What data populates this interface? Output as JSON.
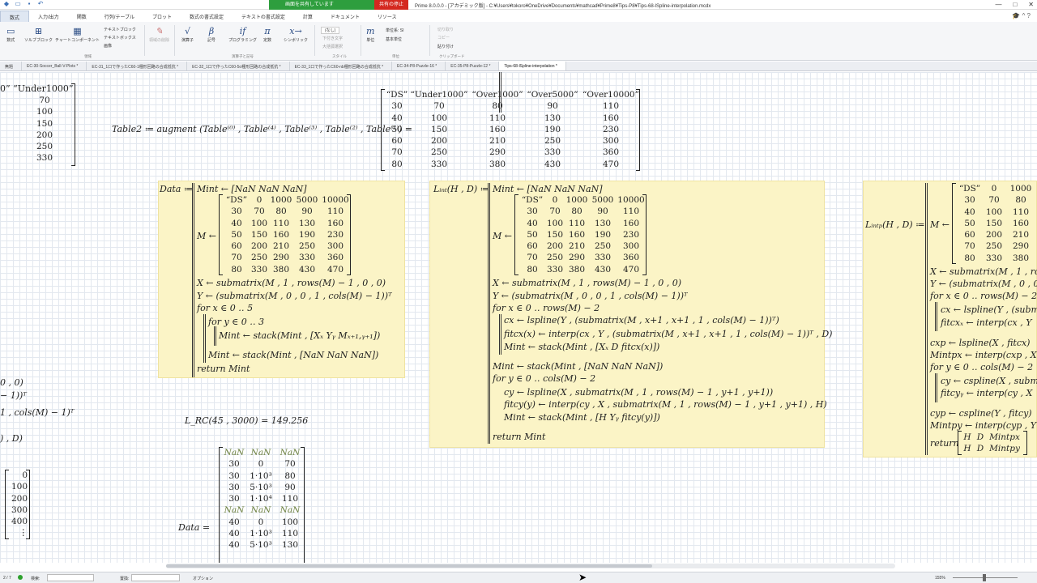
{
  "titlebar": {
    "share_banner": "画面を共有しています",
    "stop_share": "共有の停止",
    "window_title": "Prime 8.0.0.0 - [アカデミック版] - C:¥Users¥tokoro¥OneDrive¥Documents¥mathcad¥Prime8¥Tips-P8¥Tips-68-lSpline-interpolation.mcdx",
    "min": "—",
    "max": "□",
    "close": "✕"
  },
  "ribbon_tabs": [
    "数式",
    "入力/出力",
    "関数",
    "行列/テーブル",
    "プロット",
    "数式の書式設定",
    "テキストの書式設定",
    "計算",
    "ドキュメント",
    "リソース"
  ],
  "ribbon": {
    "b_math": "数式",
    "b_solve": "ソルブブロック",
    "b_chart": "チャートコンポーネント",
    "b_textblock": "テキストブロック",
    "b_textbox": "テキストボックス",
    "b_image": "画像",
    "b_clear": "領域の削除",
    "b_operator": "演算子",
    "b_symbols": "記号",
    "b_programming": "プログラミング",
    "b_constants": "定数",
    "b_symbolic": "シンボリック",
    "style_label": "(なし)",
    "style_sub": "ラベル(-)",
    "style_a": "下付き文字",
    "style_b": "大括弧選択",
    "b_units": "単位",
    "units_a": "単位系: SI",
    "units_b": "基本単位",
    "cut": "切り取り",
    "copy": "コピー",
    "paste": "貼り付け",
    "g_regions": "領域",
    "g_operators": "演算子と記号",
    "g_style": "スタイル",
    "g_units": "単位",
    "g_clipboard": "クリップボード",
    "icon_math": "▭",
    "icon_solve": "⊞",
    "icon_chart": "▦",
    "icon_op": "√",
    "icon_sym": "β",
    "icon_prog": "if",
    "icon_const": "π",
    "icon_symb": "x→",
    "icon_units": "m"
  },
  "doc_tabs": [
    "無題",
    "EC-30-Soccer_Ball-V-Plots *",
    "EC-31_1口で作ったC60-1種形回路の合成抵抗 *",
    "EC-32_1口で作ったC60-5o種形回路の合成抵抗 *",
    "EC-33_1口で作ったC60-nb種形回路の合成抵抗 *",
    "EC-34-P8-Puzzle-16 *",
    "EC-35-P8-Puzzle-12 *",
    "Tips-68-lSpline-interpolation *"
  ],
  "sheet": {
    "left_partial": {
      "h0": "0”",
      "h1": "“Under1000”",
      "vals": [
        "70",
        "100",
        "150",
        "200",
        "250",
        "330"
      ]
    },
    "table2_lhs": "Table2 ≔ augment",
    "table2_args": "(Table⁽⁰⁾ , Table⁽⁴⁾ , Table⁽³⁾ , Table⁽²⁾ , Table⁽¹⁾) =",
    "table2": [
      [
        "“DS”",
        "“Under1000”",
        "“Over1000”",
        "“Over5000”",
        "“Over10000”"
      ],
      [
        "30",
        "70",
        "80",
        "90",
        "110"
      ],
      [
        "40",
        "100",
        "110",
        "130",
        "160"
      ],
      [
        "50",
        "150",
        "160",
        "190",
        "230"
      ],
      [
        "60",
        "200",
        "210",
        "250",
        "300"
      ],
      [
        "70",
        "250",
        "290",
        "330",
        "360"
      ],
      [
        "80",
        "330",
        "380",
        "430",
        "470"
      ]
    ],
    "data_def": "Data ≔",
    "m_matrix": [
      [
        "“DS”",
        "0",
        "1000",
        "5000",
        "10000"
      ],
      [
        "30",
        "70",
        "80",
        "90",
        "110"
      ],
      [
        "40",
        "100",
        "110",
        "130",
        "160"
      ],
      [
        "50",
        "150",
        "160",
        "190",
        "230"
      ],
      [
        "60",
        "200",
        "210",
        "250",
        "300"
      ],
      [
        "70",
        "250",
        "290",
        "330",
        "360"
      ],
      [
        "80",
        "330",
        "380",
        "430",
        "470"
      ]
    ],
    "mint_init": "Mint ← [NaN  NaN  NaN]",
    "m_arrow": "M ←",
    "data_lines": [
      "X ← submatrix(M , 1 , rows(M) − 1 , 0 , 0)",
      "Y ← (submatrix(M , 0 , 0 , 1 , cols(M) − 1))ᵀ",
      "for x ∈ 0 ‥ 5",
      "for y ∈ 0 ‥ 3",
      "Mint ← stack(Mint , [Xₓ  Yᵧ  Mₓ₊₁,ᵧ₊₁])",
      "Mint ← stack(Mint , [NaN  NaN  NaN])",
      "return Mint"
    ],
    "lint_def": "Lᵢₙₜ(H , D) ≔",
    "lint_lines": [
      "X ← submatrix(M , 1 , rows(M) − 1 , 0 , 0)",
      "Y ← (submatrix(M , 0 , 0 , 1 , cols(M) − 1))ᵀ",
      "for x ∈ 0 ‥ rows(M) − 2",
      "cx ← lspline(Y , (submatrix(M , x+1 , x+1 , 1 , cols(M) − 1))ᵀ)",
      "fitcx(x) ← interp(cx , Y , (submatrix(M , x+1 , x+1 , 1 , cols(M) − 1))ᵀ , D)",
      "Mint ← stack(Mint , [Xₓ  D  fitcx(x)])",
      "Mint ← stack(Mint , [NaN  NaN  NaN])",
      "for y ∈ 0 ‥ cols(M) − 2",
      "cy ← lspline(X , submatrix(M , 1 , rows(M) − 1 , y+1 , y+1))",
      "fitcy(y) ← interp(cy , X , submatrix(M , 1 , rows(M) − 1 , y+1 , y+1) , H)",
      "Mint ← stack(Mint , [H  Yᵧ  fitcy(y)])",
      "return Mint"
    ],
    "lintp_def": "Lᵢₙₜₚ(H , D) ≔",
    "lintp_matrix": [
      [
        "“DS”",
        "0",
        "1000"
      ],
      [
        "30",
        "70",
        "80"
      ],
      [
        "40",
        "100",
        "110"
      ],
      [
        "50",
        "150",
        "160"
      ],
      [
        "60",
        "200",
        "210"
      ],
      [
        "70",
        "250",
        "290"
      ],
      [
        "80",
        "330",
        "380"
      ]
    ],
    "lintp_lines": [
      "X ← submatrix(M , 1 , ro",
      "Y ← (submatrix(M , 0 , 0",
      "for x ∈ 0 ‥ rows(M) − 2",
      "cx ← lspline(Y , (subm",
      "fitcxₓ ← interp(cx , Y",
      "cxp ← lspline(X , fitcx)",
      "Mintpx ← interp(cxp , X",
      "for y ∈ 0 ‥ cols(M) − 2",
      "cy ← cspline(X , subm",
      "fitcyᵧ ← interp(cy , X",
      "cyp ← cspline(Y , fitcy)",
      "Mintpy ← interp(cyp , Y",
      "return"
    ],
    "lintp_return_matrix": [
      [
        "H",
        "D",
        "Mintpx"
      ],
      [
        "H",
        "D",
        "Mintpy"
      ]
    ],
    "left_fragments": [
      "0 , 0)",
      "− 1))ᵀ",
      "1 , cols(M) − 1)ᵀ",
      ") , D)"
    ],
    "lrc_eval": "L_RC(45 , 3000) = 149.256",
    "left_vec": [
      "0",
      "100",
      "200",
      "300",
      "400",
      "⋮"
    ],
    "data_eq": "Data =",
    "data_result": [
      [
        "NaN",
        "NaN",
        "NaN"
      ],
      [
        "30",
        "0",
        "70"
      ],
      [
        "30",
        "1·10³",
        "80"
      ],
      [
        "30",
        "5·10³",
        "90"
      ],
      [
        "30",
        "1·10⁴",
        "110"
      ],
      [
        "NaN",
        "NaN",
        "NaN"
      ],
      [
        "40",
        "0",
        "100"
      ],
      [
        "40",
        "1·10³",
        "110"
      ],
      [
        "40",
        "5·10³",
        "130"
      ]
    ]
  },
  "statusbar": {
    "page": "2 / 7",
    "search": "検索:",
    "replace": "置換:",
    "options": "オプション",
    "zoom": "155%"
  }
}
